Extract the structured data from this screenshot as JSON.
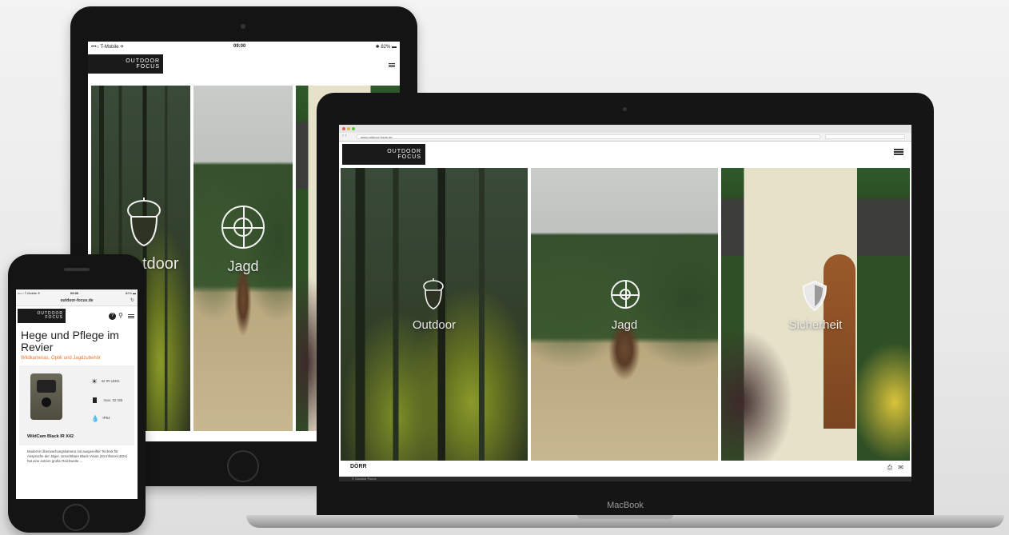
{
  "tablet": {
    "status": {
      "carrier": "•••○ T-Mobile ✈",
      "time": "09:00",
      "battery": "✱ 82% ▬"
    },
    "logo": {
      "line1": "OUTDOOR",
      "line2": "FOCUS"
    },
    "panels": [
      {
        "label": "tdoor",
        "icon": "acorn-icon"
      },
      {
        "label": "Jagd",
        "icon": "crosshair-icon"
      },
      {
        "label": "",
        "icon": ""
      }
    ]
  },
  "laptop": {
    "address": "www.outdoor-focus.de",
    "logo": {
      "line1": "OUTDOOR",
      "line2": "FOCUS"
    },
    "panels": [
      {
        "label": "Outdoor",
        "icon": "acorn-icon"
      },
      {
        "label": "Jagd",
        "icon": "crosshair-icon"
      },
      {
        "label": "Sicherheit",
        "icon": "shield-icon"
      }
    ],
    "footer": {
      "brand": "DÖRR",
      "copyright": "© Outdoor Focus"
    },
    "model": "MacBook"
  },
  "phone": {
    "status": {
      "carrier": "••○○ T-Mobile ✈",
      "time": "09:00",
      "battery": "82% ▬"
    },
    "address": "outdoor-focus.de",
    "logo": {
      "line1": "OUTDOOR",
      "line2": "FOCUS"
    },
    "headline": "Hege und Pflege im Revier",
    "subline": "Wildkameras, Optik und Jagdzubehör",
    "specs": [
      {
        "icon": "sun-icon",
        "text": "42 IR LEDs"
      },
      {
        "icon": "sd-card-icon",
        "text": "max. 32 GB"
      },
      {
        "icon": "drop-icon",
        "text": "IP54"
      }
    ],
    "product_title": "WildCam Black IR X42",
    "description": "Moderne Überwachungskamera mit ausgereifter Technik für Ansprüche der Jäger. Unsichtbare Black Vision (40 Infrarot-LEDs) hat eine extrem große Reichweite ..."
  },
  "colors": {
    "accent": "#e8772e",
    "logo_bg": "#1a1a1a",
    "device_frame": "#151515"
  }
}
